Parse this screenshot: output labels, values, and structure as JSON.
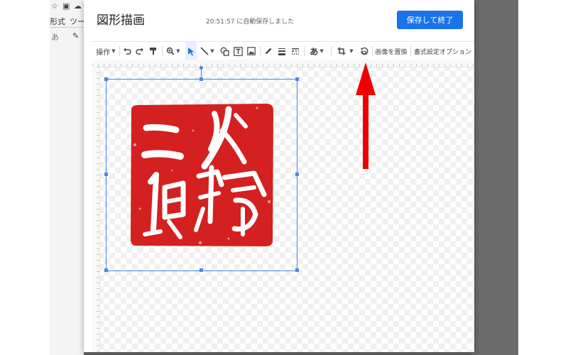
{
  "background": {
    "menu_items": [
      "形式",
      "ツー"
    ],
    "icons": [
      "star-icon",
      "folder-icon",
      "cloud-icon"
    ]
  },
  "dialog": {
    "title": "図形描画",
    "autosave_status": "20:51:57 に自動保存しました",
    "save_button": "保存して終了"
  },
  "toolbar": {
    "actions_label": "操作",
    "text_style_label": "あ",
    "replace_image_label": "画像を置換",
    "format_options_label": "書式設定オプション",
    "icons": [
      "undo-icon",
      "redo-icon",
      "paint-format-icon",
      "zoom-icon",
      "select-icon",
      "line-icon",
      "shape-icon",
      "textbox-icon",
      "image-icon",
      "pen-icon",
      "line-weight-icon",
      "line-dash-icon",
      "crop-icon",
      "mask-image-icon"
    ]
  },
  "canvas": {
    "image": "red-seal-stamp"
  },
  "colors": {
    "accent": "#1a73e8",
    "selection": "#4a86e8",
    "seal_red": "#d42020",
    "arrow_red": "#ee0000"
  }
}
